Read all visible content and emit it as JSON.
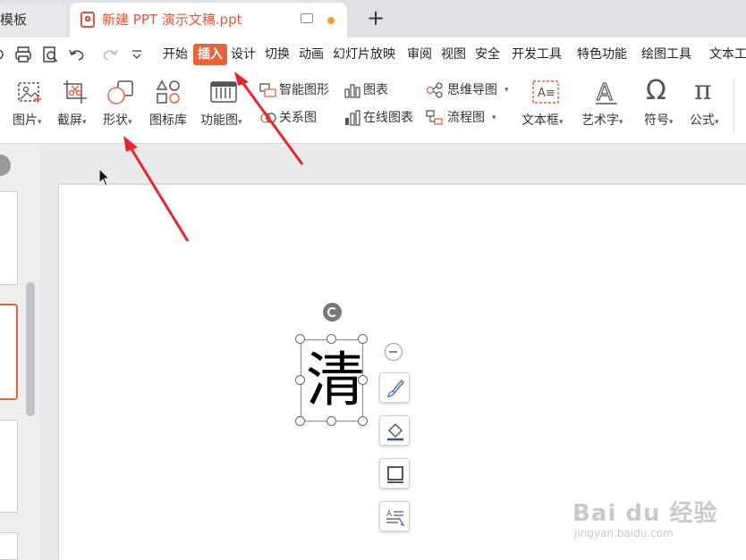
{
  "tabs": {
    "previous_label": "模板",
    "active_title": "新建 PPT 演示文稿.ppt",
    "new_tab_label": "+"
  },
  "quick_access": {
    "icons": [
      "print-icon",
      "print-preview-icon",
      "undo-icon",
      "redo-icon",
      "customize-dropdown-icon"
    ]
  },
  "menu": {
    "items": [
      "开始",
      "插入",
      "设计",
      "切换",
      "动画",
      "幻灯片放映",
      "审阅",
      "视图",
      "安全",
      "开发工具",
      "特色功能",
      "绘图工具",
      "文本工"
    ],
    "active_index": 1,
    "active_color": "#e8643c"
  },
  "ribbon": {
    "picture": "图片",
    "screenshot": "截屏",
    "shapes": "形状",
    "icon_library": "图标库",
    "function_chart": "功能图",
    "smart_art": "智能图形",
    "chart": "图表",
    "relation": "关系图",
    "online_chart": "在线图表",
    "mind_map": "思维导图",
    "flowchart": "流程图",
    "text_box": "文本框",
    "word_art": "艺术字",
    "symbol": "符号",
    "symbol_glyph": "Ω",
    "formula": "公式",
    "formula_glyph": "π",
    "textbox_glyph": "A≡",
    "wordart_glyph": "A"
  },
  "slide": {
    "text": "清"
  },
  "watermark": {
    "main": "Bai du 经验",
    "sub": "jingyan.baidu.com"
  },
  "annotations": {
    "arrow_color": "#e8262a"
  }
}
